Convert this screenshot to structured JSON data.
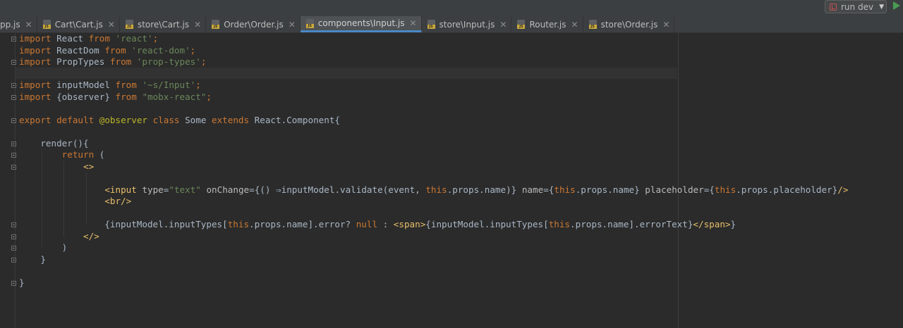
{
  "run_config": {
    "label": "run dev"
  },
  "tabs": [
    {
      "label": "pp.js",
      "active": false
    },
    {
      "label": "Cart\\Cart.js",
      "active": false
    },
    {
      "label": "store\\Cart.js",
      "active": false
    },
    {
      "label": "Order\\Order.js",
      "active": false
    },
    {
      "label": "components\\Input.js",
      "active": true
    },
    {
      "label": "store\\Input.js",
      "active": false
    },
    {
      "label": "Router.js",
      "active": false
    },
    {
      "label": "store\\Order.js",
      "active": false
    }
  ],
  "code": [
    [
      [
        "kw",
        "import"
      ],
      [
        "plain",
        " React "
      ],
      [
        "kw",
        "from"
      ],
      [
        "plain",
        " "
      ],
      [
        "str",
        "'react'"
      ],
      [
        "kw",
        ";"
      ]
    ],
    [
      [
        "kw",
        "import"
      ],
      [
        "plain",
        " ReactDom "
      ],
      [
        "kw",
        "from"
      ],
      [
        "plain",
        " "
      ],
      [
        "str",
        "'react-dom'"
      ],
      [
        "kw",
        ";"
      ]
    ],
    [
      [
        "kw",
        "import"
      ],
      [
        "plain",
        " PropTypes "
      ],
      [
        "kw",
        "from"
      ],
      [
        "plain",
        " "
      ],
      [
        "str",
        "'prop-types'"
      ],
      [
        "kw",
        ";"
      ]
    ],
    [],
    [
      [
        "kw",
        "import"
      ],
      [
        "plain",
        " inputModel "
      ],
      [
        "kw",
        "from"
      ],
      [
        "plain",
        " "
      ],
      [
        "str",
        "'~s/Input'"
      ],
      [
        "kw",
        ";"
      ]
    ],
    [
      [
        "kw",
        "import"
      ],
      [
        "plain",
        " {observer} "
      ],
      [
        "kw",
        "from"
      ],
      [
        "plain",
        " "
      ],
      [
        "str",
        "\"mobx-react\""
      ],
      [
        "kw",
        ";"
      ]
    ],
    [],
    [
      [
        "kw",
        "export default"
      ],
      [
        "plain",
        " "
      ],
      [
        "ann",
        "@observer"
      ],
      [
        "plain",
        " "
      ],
      [
        "kw",
        "class"
      ],
      [
        "plain",
        " Some "
      ],
      [
        "kw",
        "extends"
      ],
      [
        "plain",
        " React.Component{"
      ]
    ],
    [],
    [
      [
        "plain",
        "    render(){"
      ]
    ],
    [
      [
        "plain",
        "        "
      ],
      [
        "kw",
        "return"
      ],
      [
        "plain",
        " ("
      ]
    ],
    [
      [
        "plain",
        "            "
      ],
      [
        "tag",
        "<>"
      ]
    ],
    [],
    [
      [
        "plain",
        "                "
      ],
      [
        "tag",
        "<input"
      ],
      [
        "plain",
        " "
      ],
      [
        "attr",
        "type"
      ],
      [
        "plain",
        "="
      ],
      [
        "str",
        "\"text\""
      ],
      [
        "plain",
        " "
      ],
      [
        "attr",
        "onChange"
      ],
      [
        "plain",
        "={() ⇒inputModel.validate(event, "
      ],
      [
        "this",
        "this"
      ],
      [
        "plain",
        ".props.name)} "
      ],
      [
        "attr",
        "name"
      ],
      [
        "plain",
        "={"
      ],
      [
        "this",
        "this"
      ],
      [
        "plain",
        ".props.name} "
      ],
      [
        "attr",
        "placeholder"
      ],
      [
        "plain",
        "={"
      ],
      [
        "this",
        "this"
      ],
      [
        "plain",
        ".props.placeholder}"
      ],
      [
        "tag",
        "/>"
      ]
    ],
    [
      [
        "plain",
        "                "
      ],
      [
        "tag",
        "<br/>"
      ]
    ],
    [],
    [
      [
        "plain",
        "                {inputModel.inputTypes["
      ],
      [
        "this",
        "this"
      ],
      [
        "plain",
        ".props.name].error? "
      ],
      [
        "kw",
        "null"
      ],
      [
        "plain",
        " : "
      ],
      [
        "tag",
        "<span>"
      ],
      [
        "plain",
        "{inputModel.inputTypes["
      ],
      [
        "this",
        "this"
      ],
      [
        "plain",
        ".props.name].errorText}"
      ],
      [
        "tag",
        "</span>"
      ],
      [
        "plain",
        "}"
      ]
    ],
    [
      [
        "plain",
        "            "
      ],
      [
        "tag",
        "</>"
      ]
    ],
    [
      [
        "plain",
        "        )"
      ]
    ],
    [
      [
        "plain",
        "    }"
      ]
    ],
    [],
    [
      [
        "plain",
        "}"
      ]
    ]
  ]
}
